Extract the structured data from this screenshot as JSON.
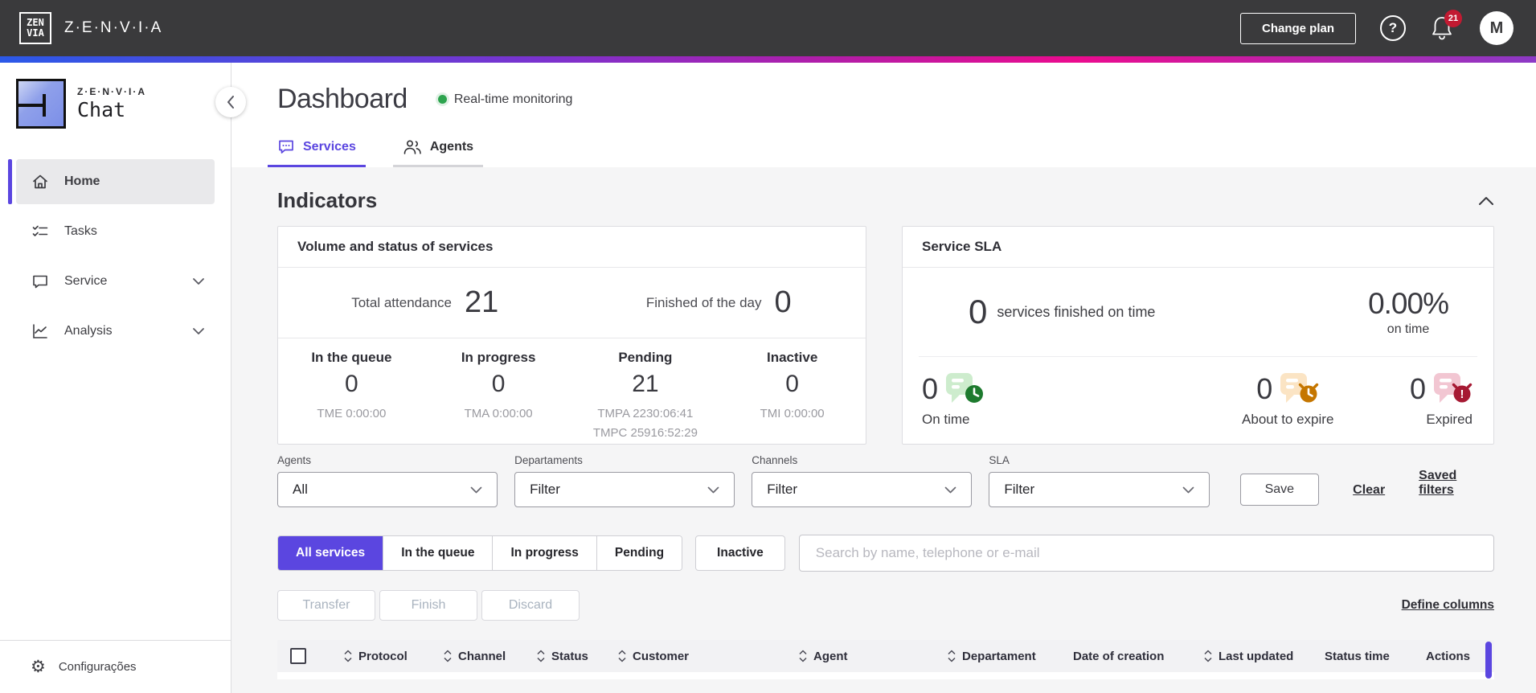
{
  "colors": {
    "accent": "#5b46e0",
    "success_green": "#2da44e",
    "sla_green": "#1d7a2e",
    "sla_orange": "#c57600",
    "sla_red": "#a61933",
    "badge_red": "#c21a32"
  },
  "topbar": {
    "brand": "Z·E·N·V·I·A",
    "logo_line1": "ZEN",
    "logo_line2": "VIA",
    "change_plan_label": "Change plan",
    "notification_count": "21",
    "avatar_initial": "M",
    "help_glyph": "?"
  },
  "sidebar": {
    "logo_brand": "Z·E·N·V·I·A",
    "logo_product": "Chat",
    "items": [
      {
        "label": "Home"
      },
      {
        "label": "Tasks"
      },
      {
        "label": "Service"
      },
      {
        "label": "Analysis"
      }
    ],
    "settings_label": "Configurações",
    "gear_glyph": "⚙"
  },
  "header": {
    "title": "Dashboard",
    "status_label": "Real-time monitoring"
  },
  "tabs": {
    "services": "Services",
    "agents": "Agents"
  },
  "indicators": {
    "heading": "Indicators",
    "volume_card": {
      "title": "Volume and status of services",
      "total_attendance_label": "Total attendance",
      "total_attendance_value": "21",
      "finished_label": "Finished of the day",
      "finished_value": "0",
      "stats": [
        {
          "label": "In the queue",
          "value": "0",
          "sub1": "TME 0:00:00"
        },
        {
          "label": "In progress",
          "value": "0",
          "sub1": "TMA 0:00:00"
        },
        {
          "label": "Pending",
          "value": "21",
          "sub1": "TMPA 2230:06:41",
          "sub2": "TMPC 25916:52:29"
        },
        {
          "label": "Inactive",
          "value": "0",
          "sub1": "TMI 0:00:00"
        }
      ]
    },
    "sla_card": {
      "title": "Service SLA",
      "finished_value": "0",
      "finished_label": "services finished on time",
      "percent_value": "0.00%",
      "percent_label": "on time",
      "stats": [
        {
          "value": "0",
          "label": "On time"
        },
        {
          "value": "0",
          "label": "About to expire"
        },
        {
          "value": "0",
          "label": "Expired"
        }
      ]
    }
  },
  "filters": {
    "agents_label": "Agents",
    "agents_value": "All",
    "departments_label": "Departaments",
    "departments_value": "Filter",
    "channels_label": "Channels",
    "channels_value": "Filter",
    "sla_label": "SLA",
    "sla_value": "Filter",
    "save_label": "Save",
    "clear_label": "Clear",
    "saved_filters_label": "Saved filters"
  },
  "services_toolbar": {
    "segments": [
      {
        "label": "All services"
      },
      {
        "label": "In the queue"
      },
      {
        "label": "In progress"
      },
      {
        "label": "Pending"
      }
    ],
    "inactive_label": "Inactive",
    "search_placeholder": "Search by name, telephone or e-mail",
    "transfer_label": "Transfer",
    "finish_label": "Finish",
    "discard_label": "Discard",
    "define_columns_label": "Define columns"
  },
  "table": {
    "columns": [
      {
        "label": "Protocol",
        "sortable": true
      },
      {
        "label": "Channel",
        "sortable": true
      },
      {
        "label": "Status",
        "sortable": true
      },
      {
        "label": "Customer",
        "sortable": true
      },
      {
        "label": "Agent",
        "sortable": true
      },
      {
        "label": "Departament",
        "sortable": true
      },
      {
        "label": "Date of creation",
        "sortable": false
      },
      {
        "label": "Last updated",
        "sortable": true
      },
      {
        "label": "Status time",
        "sortable": false
      },
      {
        "label": "Actions",
        "sortable": false
      }
    ]
  }
}
